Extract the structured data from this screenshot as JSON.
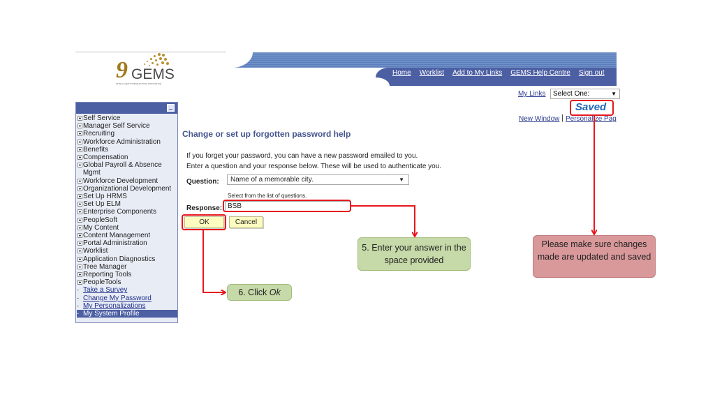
{
  "logo": {
    "brand": "GEMS",
    "tagline": "INTELLIGENT INTERACTIVE INNOVATIVE"
  },
  "header": {
    "nav": [
      {
        "label": "Home"
      },
      {
        "label": "Worklist"
      },
      {
        "label": "Add to My Links"
      },
      {
        "label": "GEMS Help Centre"
      },
      {
        "label": "Sign out"
      }
    ],
    "my_links_label": "My Links",
    "my_links_select": "Select One:",
    "new_window": "New Window",
    "separator": "|",
    "personalize_page": "Personalize Page",
    "saved_label": "Saved"
  },
  "sidebar": {
    "items": [
      {
        "label": "Self Service",
        "type": "folder"
      },
      {
        "label": "Manager Self Service",
        "type": "folder"
      },
      {
        "label": "Recruiting",
        "type": "folder"
      },
      {
        "label": "Workforce Administration",
        "type": "folder"
      },
      {
        "label": "Benefits",
        "type": "folder"
      },
      {
        "label": "Compensation",
        "type": "folder"
      },
      {
        "label": "Global Payroll & Absence Mgmt",
        "type": "folder"
      },
      {
        "label": "Workforce Development",
        "type": "folder"
      },
      {
        "label": "Organizational Development",
        "type": "folder"
      },
      {
        "label": "Set Up HRMS",
        "type": "folder"
      },
      {
        "label": "Set Up ELM",
        "type": "folder"
      },
      {
        "label": "Enterprise Components",
        "type": "folder"
      },
      {
        "label": "PeopleSoft",
        "type": "folder"
      },
      {
        "label": "My Content",
        "type": "folder"
      },
      {
        "label": "Content Management",
        "type": "folder"
      },
      {
        "label": "Portal Administration",
        "type": "folder"
      },
      {
        "label": "Worklist",
        "type": "folder"
      },
      {
        "label": "Application Diagnostics",
        "type": "folder"
      },
      {
        "label": "Tree Manager",
        "type": "folder"
      },
      {
        "label": "Reporting Tools",
        "type": "folder"
      },
      {
        "label": "PeopleTools",
        "type": "folder"
      },
      {
        "label": "Take a Survey",
        "type": "link"
      },
      {
        "label": "Change My Password",
        "type": "link"
      },
      {
        "label": "My Personalizations",
        "type": "link"
      },
      {
        "label": "My System Profile",
        "type": "active"
      }
    ]
  },
  "main": {
    "title": "Change or set up forgotten password help",
    "info_line1": "If you forget your password, you can have a new password emailed to you.",
    "info_line2": "Enter a question and your response below. These will be used to authenticate you.",
    "question_label": "Question:",
    "question_value": "Name of a memorable city.",
    "question_hint": "Select from the list of questions.",
    "response_label": "Response:",
    "response_value": "BSB",
    "ok_label": "OK",
    "cancel_label": "Cancel"
  },
  "callouts": {
    "step5": "5. Enter your answer in the space provided",
    "step6_prefix": "6. Click ",
    "step6_emph": "Ok",
    "save_note": "Please make sure changes made are updated and saved"
  },
  "colors": {
    "highlight_red": "#e8161c",
    "callout_green": "#c6d9a8",
    "callout_red": "#d9999b",
    "nav_blue": "#4c5fa3",
    "title_blue": "#45568f"
  }
}
